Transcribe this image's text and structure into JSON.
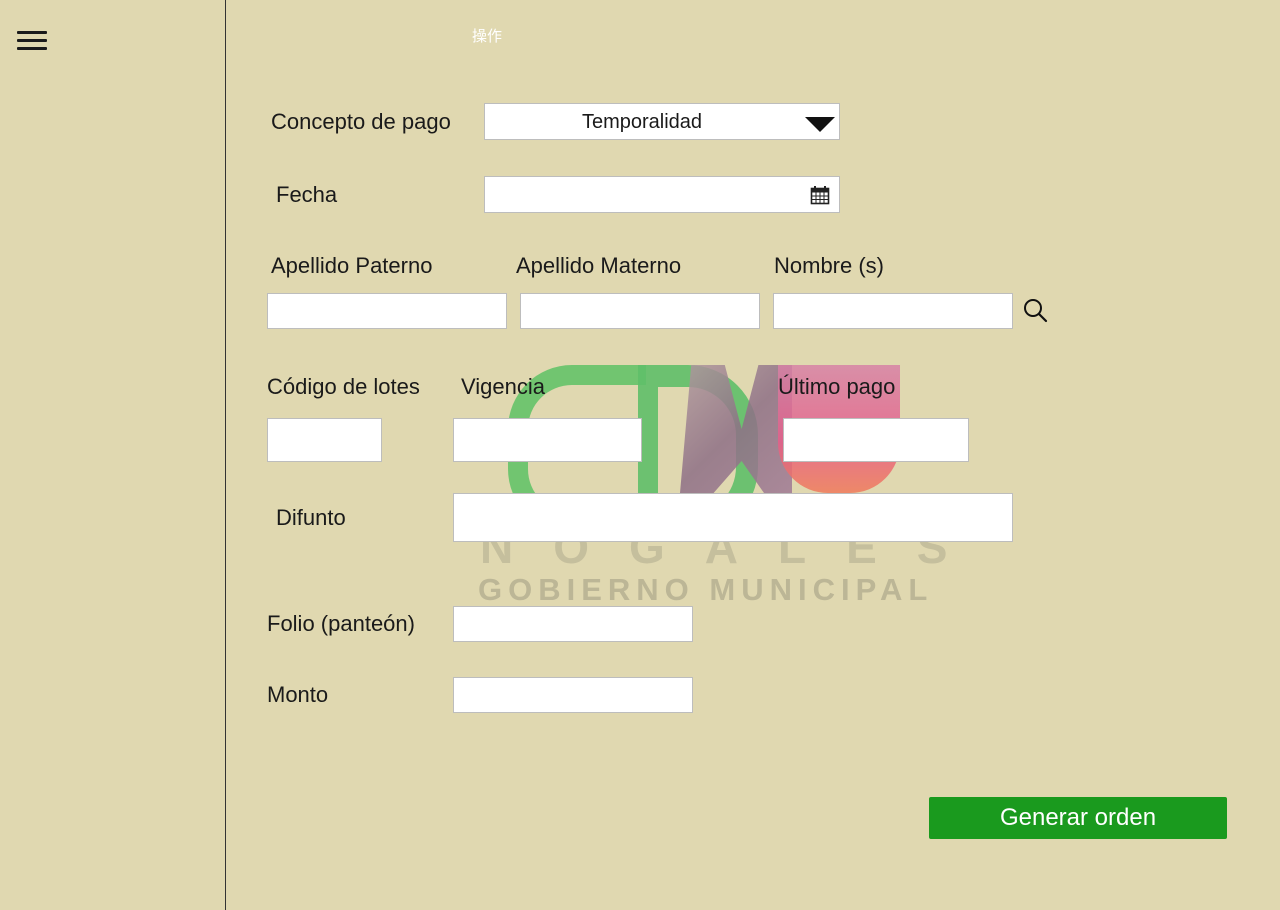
{
  "header": {
    "label": "操作"
  },
  "watermark": {
    "brand": "NOGALES",
    "subtitle": "GOBIERNO MUNICIPAL"
  },
  "form": {
    "concepto": {
      "label": "Concepto  de pago",
      "value": "Temporalidad"
    },
    "fecha": {
      "label": "Fecha",
      "value": ""
    },
    "apellido_paterno": {
      "label": "Apellido Paterno",
      "value": ""
    },
    "apellido_materno": {
      "label": "Apellido Materno",
      "value": ""
    },
    "nombre": {
      "label": "Nombre (s)",
      "value": ""
    },
    "codigo_lotes": {
      "label": "Código de lotes",
      "value": ""
    },
    "vigencia": {
      "label": "Vigencia",
      "value": ""
    },
    "ultimo_pago": {
      "label": "Último pago",
      "value": ""
    },
    "difunto": {
      "label": "Difunto",
      "value": ""
    },
    "folio": {
      "label": "Folio (panteón)",
      "value": ""
    },
    "monto": {
      "label": "Monto",
      "value": ""
    }
  },
  "actions": {
    "generate_label": "Generar orden"
  },
  "colors": {
    "background": "#e0d8b0",
    "button": "#1a9a1e"
  }
}
